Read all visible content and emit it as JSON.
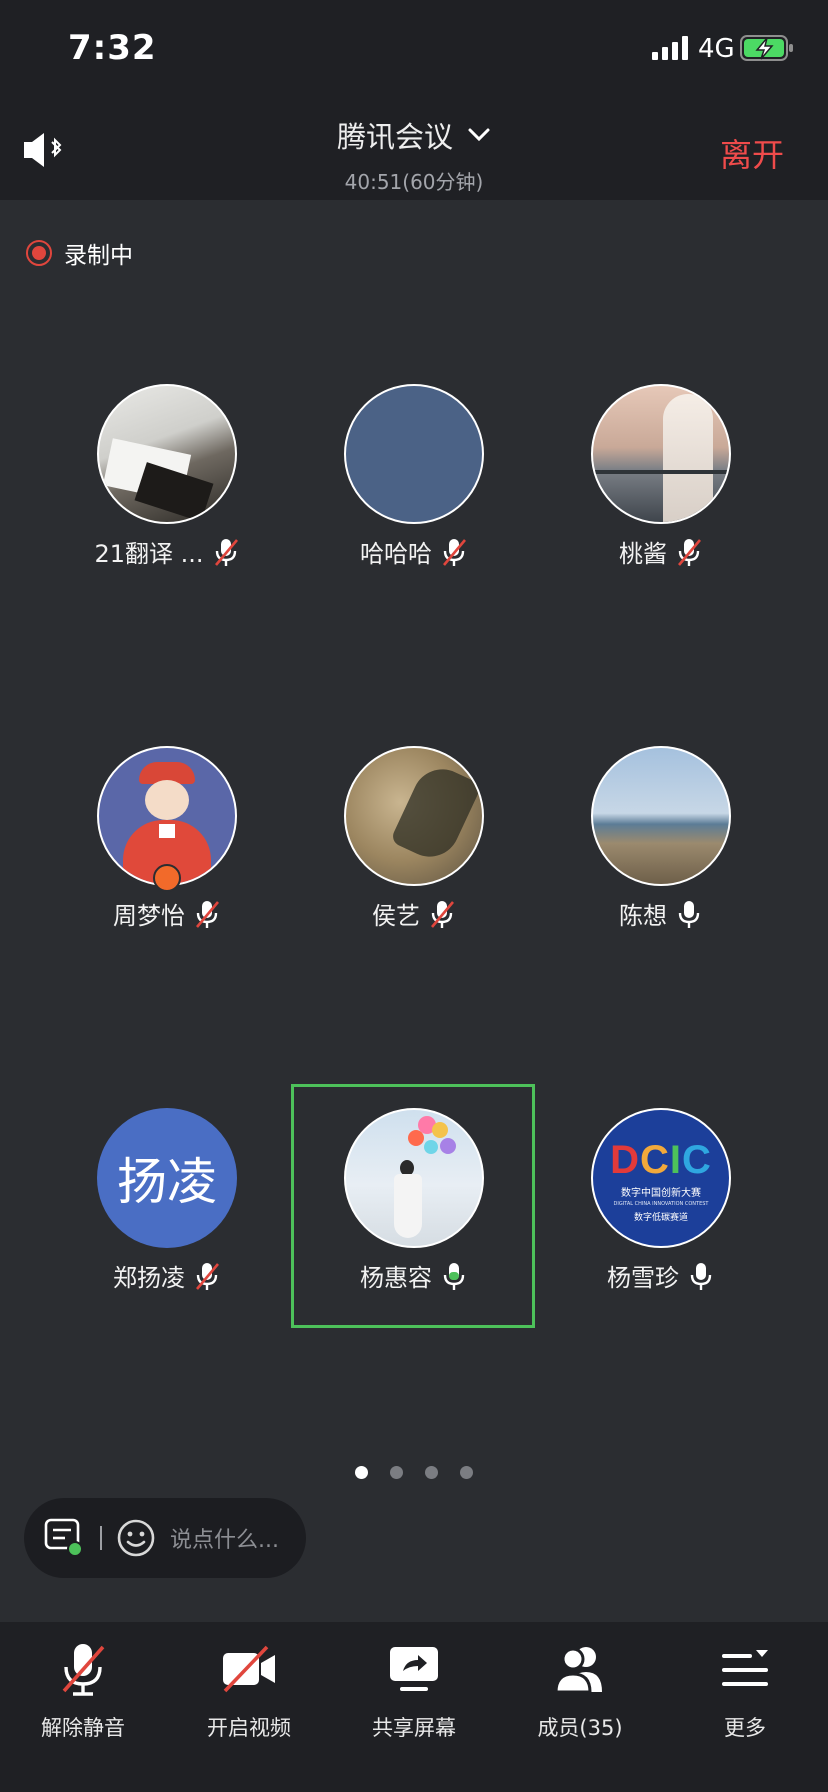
{
  "status_bar": {
    "time": "7:32",
    "network": "4G"
  },
  "header": {
    "title": "腾讯会议",
    "subtitle": "40:51(60分钟)",
    "leave_label": "离开"
  },
  "recording": {
    "label": "录制中"
  },
  "participants": [
    {
      "name": "21翻译 ...",
      "mic": "muted",
      "avatar": "photo-papers"
    },
    {
      "name": "哈哈哈",
      "mic": "muted",
      "avatar": "solid-blue"
    },
    {
      "name": "桃酱",
      "mic": "muted",
      "avatar": "photo-sunset-girl"
    },
    {
      "name": "周梦怡",
      "mic": "muted",
      "avatar": "illustration-girl",
      "host": true
    },
    {
      "name": "侯艺",
      "mic": "muted",
      "avatar": "photo-plant-shadow"
    },
    {
      "name": "陈想",
      "mic": "on",
      "avatar": "photo-coast"
    },
    {
      "name": "郑扬凌",
      "mic": "muted",
      "avatar": "text",
      "avatar_text": "扬凌"
    },
    {
      "name": "杨惠容",
      "mic": "speaking",
      "avatar": "photo-balloons",
      "active_speaker": true
    },
    {
      "name": "杨雪珍",
      "mic": "on",
      "avatar": "logo-dcic",
      "logo_text": "DCIC",
      "logo_sub1": "数字中国创新大赛",
      "logo_sub2": "DIGITAL CHINA INNOVATION CONTEST",
      "logo_sub3": "数字低碳赛道"
    }
  ],
  "pager": {
    "pages": 4,
    "current": 1
  },
  "chat": {
    "placeholder": "说点什么..."
  },
  "toolbar": {
    "unmute_label": "解除静音",
    "video_label": "开启视频",
    "share_label": "共享屏幕",
    "members_label": "成员(35)",
    "more_label": "更多"
  },
  "colors": {
    "leave": "#ef4b4b",
    "recording": "#e0463d",
    "speaking": "#4dc15a",
    "background": "#2b2d31",
    "bar": "#1f2024"
  }
}
